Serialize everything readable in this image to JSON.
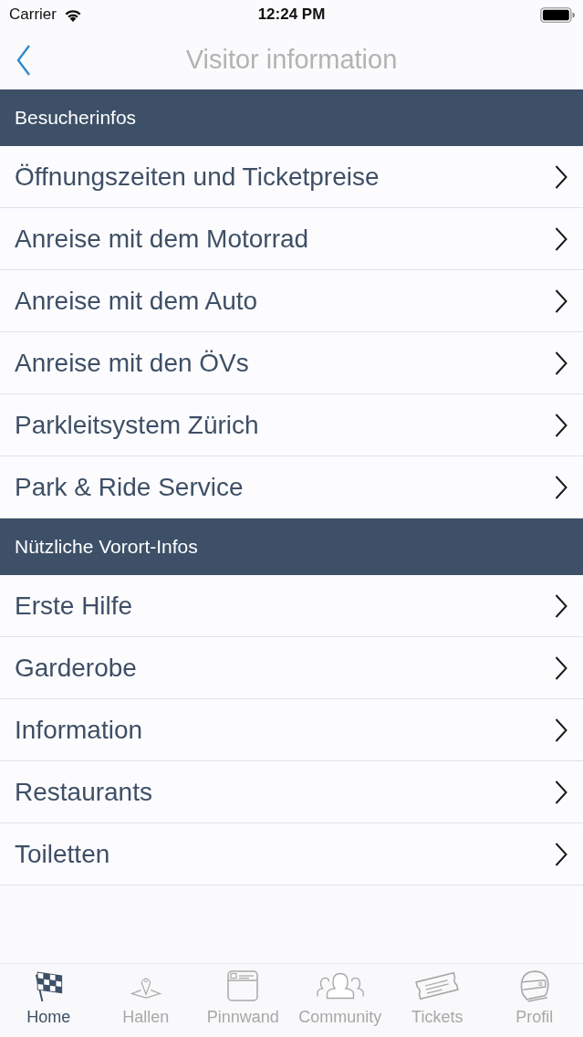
{
  "status_bar": {
    "carrier": "Carrier",
    "time": "12:24 PM"
  },
  "nav_bar": {
    "title": "Visitor information"
  },
  "sections": [
    {
      "title": "Besucherinfos",
      "items": [
        "Öffnungszeiten und Ticketpreise",
        "Anreise mit dem Motorrad",
        "Anreise mit dem Auto",
        "Anreise mit den ÖVs",
        "Parkleitsystem Zürich",
        "Park & Ride Service"
      ]
    },
    {
      "title": "Nützliche Vorort-Infos",
      "items": [
        "Erste Hilfe",
        "Garderobe",
        "Information",
        "Restaurants",
        "Toiletten"
      ]
    }
  ],
  "tab_bar": [
    {
      "label": "Home",
      "kind": "flag",
      "selected": true
    },
    {
      "label": "Hallen",
      "kind": "pin",
      "selected": false
    },
    {
      "label": "Pinnwand",
      "kind": "board",
      "selected": false
    },
    {
      "label": "Community",
      "kind": "people",
      "selected": false
    },
    {
      "label": "Tickets",
      "kind": "ticket",
      "selected": false
    },
    {
      "label": "Profil",
      "kind": "helmet",
      "selected": false
    }
  ]
}
